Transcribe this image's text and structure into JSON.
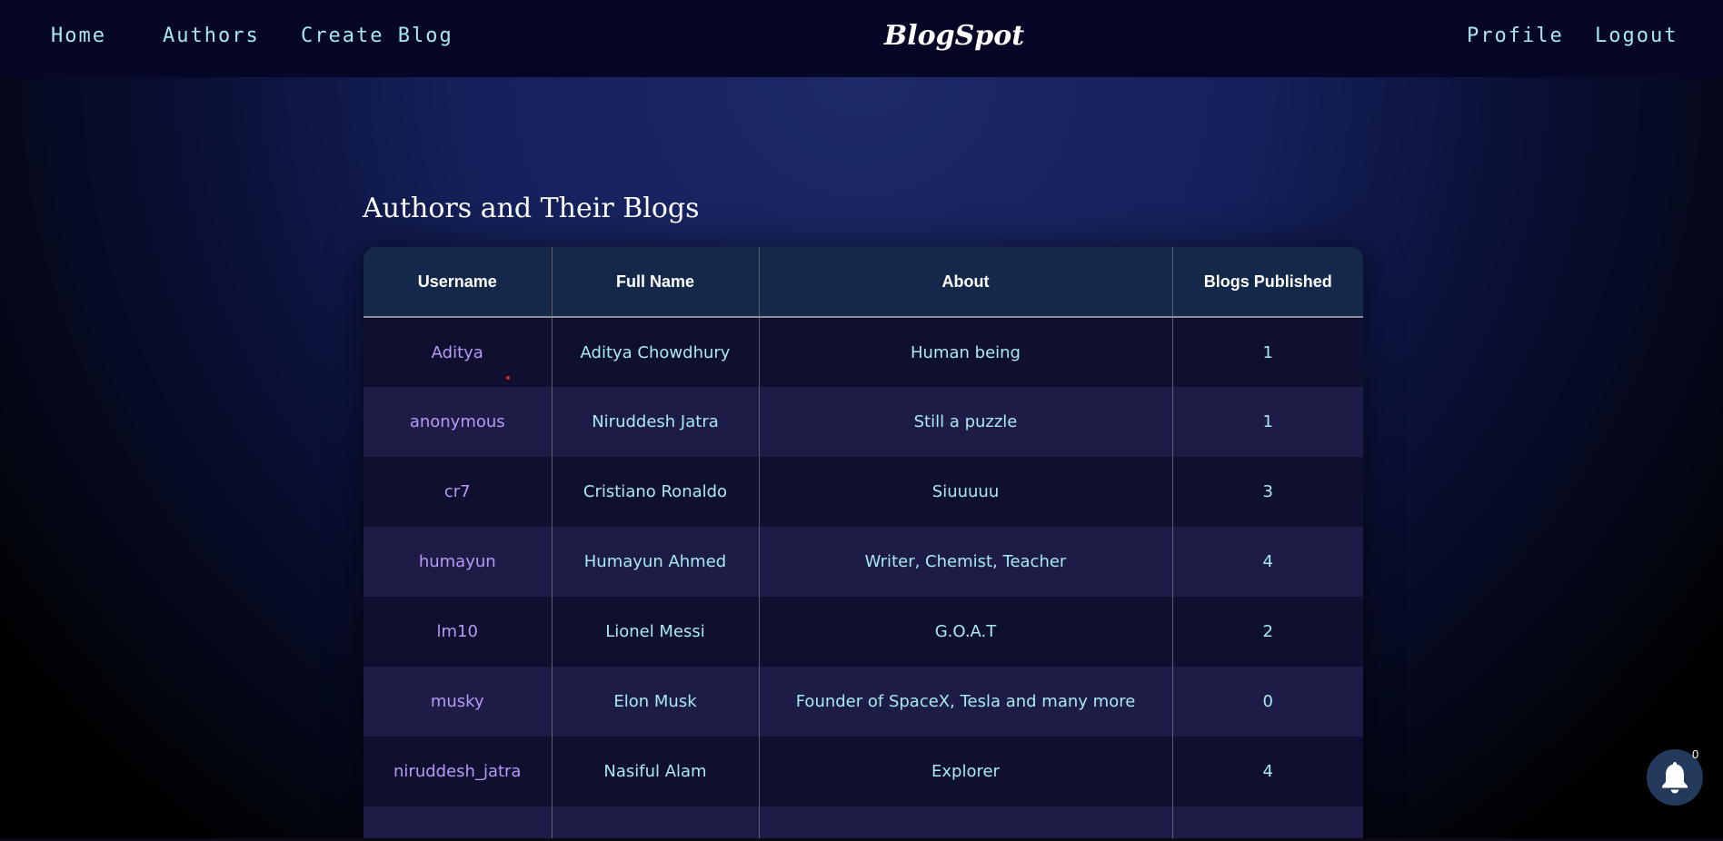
{
  "nav": {
    "home": "Home",
    "authors": "Authors",
    "create_blog": "Create Blog",
    "brand": "BlogSpot",
    "profile": "Profile",
    "logout": "Logout"
  },
  "page": {
    "title": "Authors and Their Blogs"
  },
  "table": {
    "headers": [
      "Username",
      "Full Name",
      "About",
      "Blogs Published"
    ],
    "rows": [
      {
        "username": "Aditya",
        "full_name": "Aditya Chowdhury",
        "about": "Human being",
        "blogs": "1"
      },
      {
        "username": "anonymous",
        "full_name": "Niruddesh Jatra",
        "about": "Still a puzzle",
        "blogs": "1"
      },
      {
        "username": "cr7",
        "full_name": "Cristiano Ronaldo",
        "about": "Siuuuuu",
        "blogs": "3"
      },
      {
        "username": "humayun",
        "full_name": "Humayun Ahmed",
        "about": "Writer, Chemist, Teacher",
        "blogs": "4"
      },
      {
        "username": "lm10",
        "full_name": "Lionel Messi",
        "about": "G.O.A.T",
        "blogs": "2"
      },
      {
        "username": "musky",
        "full_name": "Elon Musk",
        "about": "Founder of SpaceX, Tesla and many more",
        "blogs": "0"
      },
      {
        "username": "niruddesh_jatra",
        "full_name": "Nasiful Alam",
        "about": "Explorer",
        "blogs": "4"
      }
    ]
  },
  "notifications": {
    "icon": "bell-icon",
    "count": "0"
  },
  "colors": {
    "nav_bg": "#060626",
    "link": "#a8e7ee",
    "username_link": "#b79af5",
    "header_bg": "#14284a",
    "row_odd": "#0f0f30",
    "row_even": "#1d1c47"
  }
}
